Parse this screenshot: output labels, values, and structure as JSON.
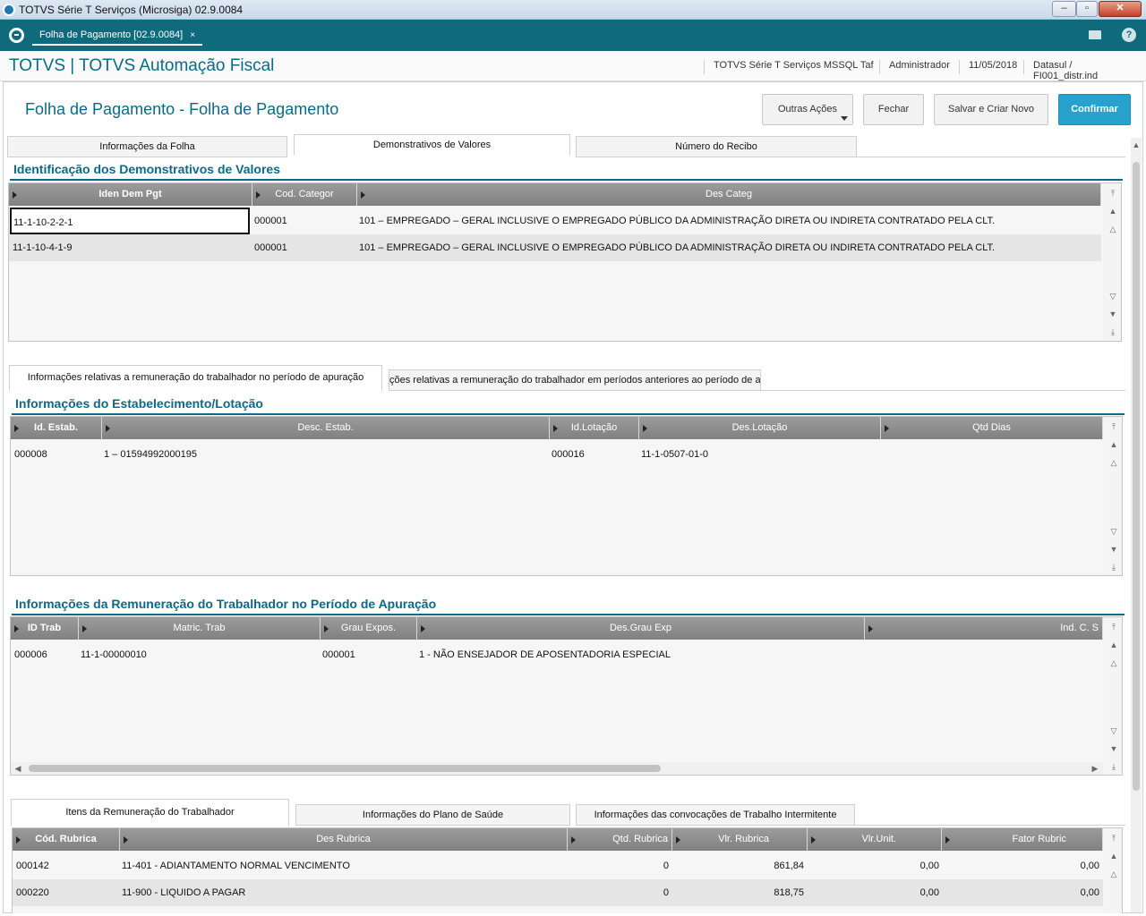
{
  "window": {
    "title": "TOTVS Série T Serviços (Microsiga) 02.9.0084",
    "minimize": "–",
    "restore": "▫",
    "close": "✕"
  },
  "tabbar": {
    "tab_label": "Folha de Pagamento [02.9.0084]",
    "tab_close": "×",
    "help": "?"
  },
  "header": {
    "brand": "TOTVS | TOTVS Automação Fiscal",
    "environment": "TOTVS Série T Serviços MSSQL Taf",
    "user": "Administrador",
    "date": "11/05/2018",
    "database": "Datasul / FI001_distr.ind"
  },
  "page": {
    "title": "Folha de Pagamento - Folha de Pagamento",
    "buttons": {
      "other_actions": "Outras Ações",
      "close": "Fechar",
      "save_new": "Salvar e Criar Novo",
      "confirm": "Confirmar"
    }
  },
  "top_tabs": [
    "Informações da Folha",
    "Demonstrativos de Valores",
    "Número do Recibo"
  ],
  "demonstrativos": {
    "title": "Identificação dos Demonstrativos de Valores",
    "headers": [
      "Iden Dem Pgt",
      "Cod. Categor",
      "Des Categ"
    ],
    "rows": [
      [
        "11-1-10-2-2-1",
        "000001",
        "101 – EMPREGADO – GERAL INCLUSIVE O EMPREGADO PÚBLICO DA ADMINISTRAÇÃO DIRETA OU INDIRETA CONTRATADO PELA CLT."
      ],
      [
        "11-1-10-4-1-9",
        "000001",
        "101 – EMPREGADO – GERAL INCLUSIVE O EMPREGADO PÚBLICO DA ADMINISTRAÇÃO DIRETA OU INDIRETA CONTRATADO PELA CLT."
      ]
    ]
  },
  "period_tabs": [
    "Informações relativas a remuneração do trabalhador no período de apuração",
    "ções relativas a remuneração do trabalhador em períodos anteriores ao período de a"
  ],
  "estabelecimento": {
    "title": "Informações do Estabelecimento/Lotação",
    "headers": [
      "Id. Estab.",
      "Desc. Estab.",
      "Id.Lotação",
      "Des.Lotação",
      "Qtd Dias"
    ],
    "rows": [
      [
        "000008",
        "1 – 01594992000195",
        "000016",
        "11-1-0507-01-0",
        ""
      ]
    ]
  },
  "remuneracao": {
    "title": "Informações da Remuneração do Trabalhador no Período de Apuração",
    "headers": [
      "ID Trab",
      "Matric. Trab",
      "Grau Expos.",
      "Des.Grau Exp",
      "Ind. C. S"
    ],
    "rows": [
      [
        "000006",
        "11-1-00000010",
        "000001",
        "1 - NÃO ENSEJADOR DE APOSENTADORIA ESPECIAL",
        ""
      ]
    ]
  },
  "item_tabs": [
    "Itens da Remuneração do Trabalhador",
    "Informações do Plano de Saúde",
    "Informações das convocações de Trabalho Intermitente"
  ],
  "rubricas": {
    "headers": [
      "Cód. Rubrica",
      "Des Rubrica",
      "Qtd. Rubrica",
      "Vlr. Rubrica",
      "Vlr.Unit.",
      "Fator Rubric"
    ],
    "rows": [
      [
        "000142",
        "11-401 - ADIANTAMENTO NORMAL VENCIMENTO",
        "0",
        "861,84",
        "0,00",
        "0,00"
      ],
      [
        "000220",
        "11-900 - LIQUIDO A PAGAR",
        "0",
        "818,75",
        "0,00",
        "0,00"
      ]
    ]
  },
  "scroll_glyphs": {
    "top": "⤒",
    "up": "▲",
    "page_up": "△",
    "page_down": "▽",
    "down": "▼",
    "bottom": "⤓",
    "left": "◀",
    "right": "▶"
  }
}
